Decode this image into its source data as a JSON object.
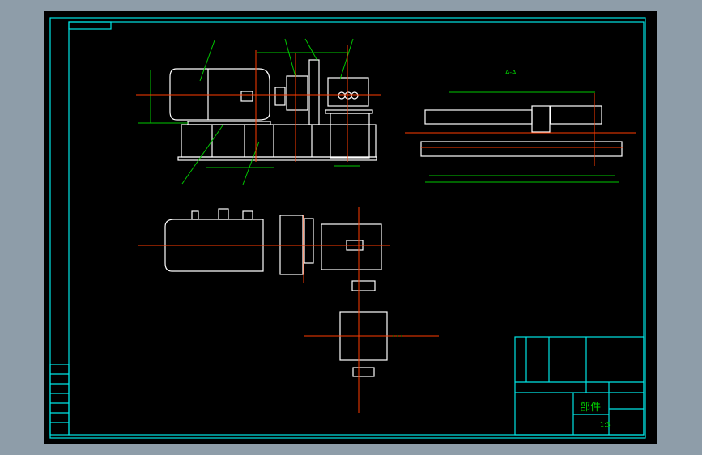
{
  "viewer": {
    "background": "#000000",
    "frame_color": "#00e5e5",
    "line_color": "#ffffff",
    "dimension_color": "#00c800",
    "centerline_color": "#ff3c00"
  },
  "drawing": {
    "section_label": "A-A",
    "title_block": {
      "part_name": "部件",
      "scale": "1:3"
    }
  }
}
